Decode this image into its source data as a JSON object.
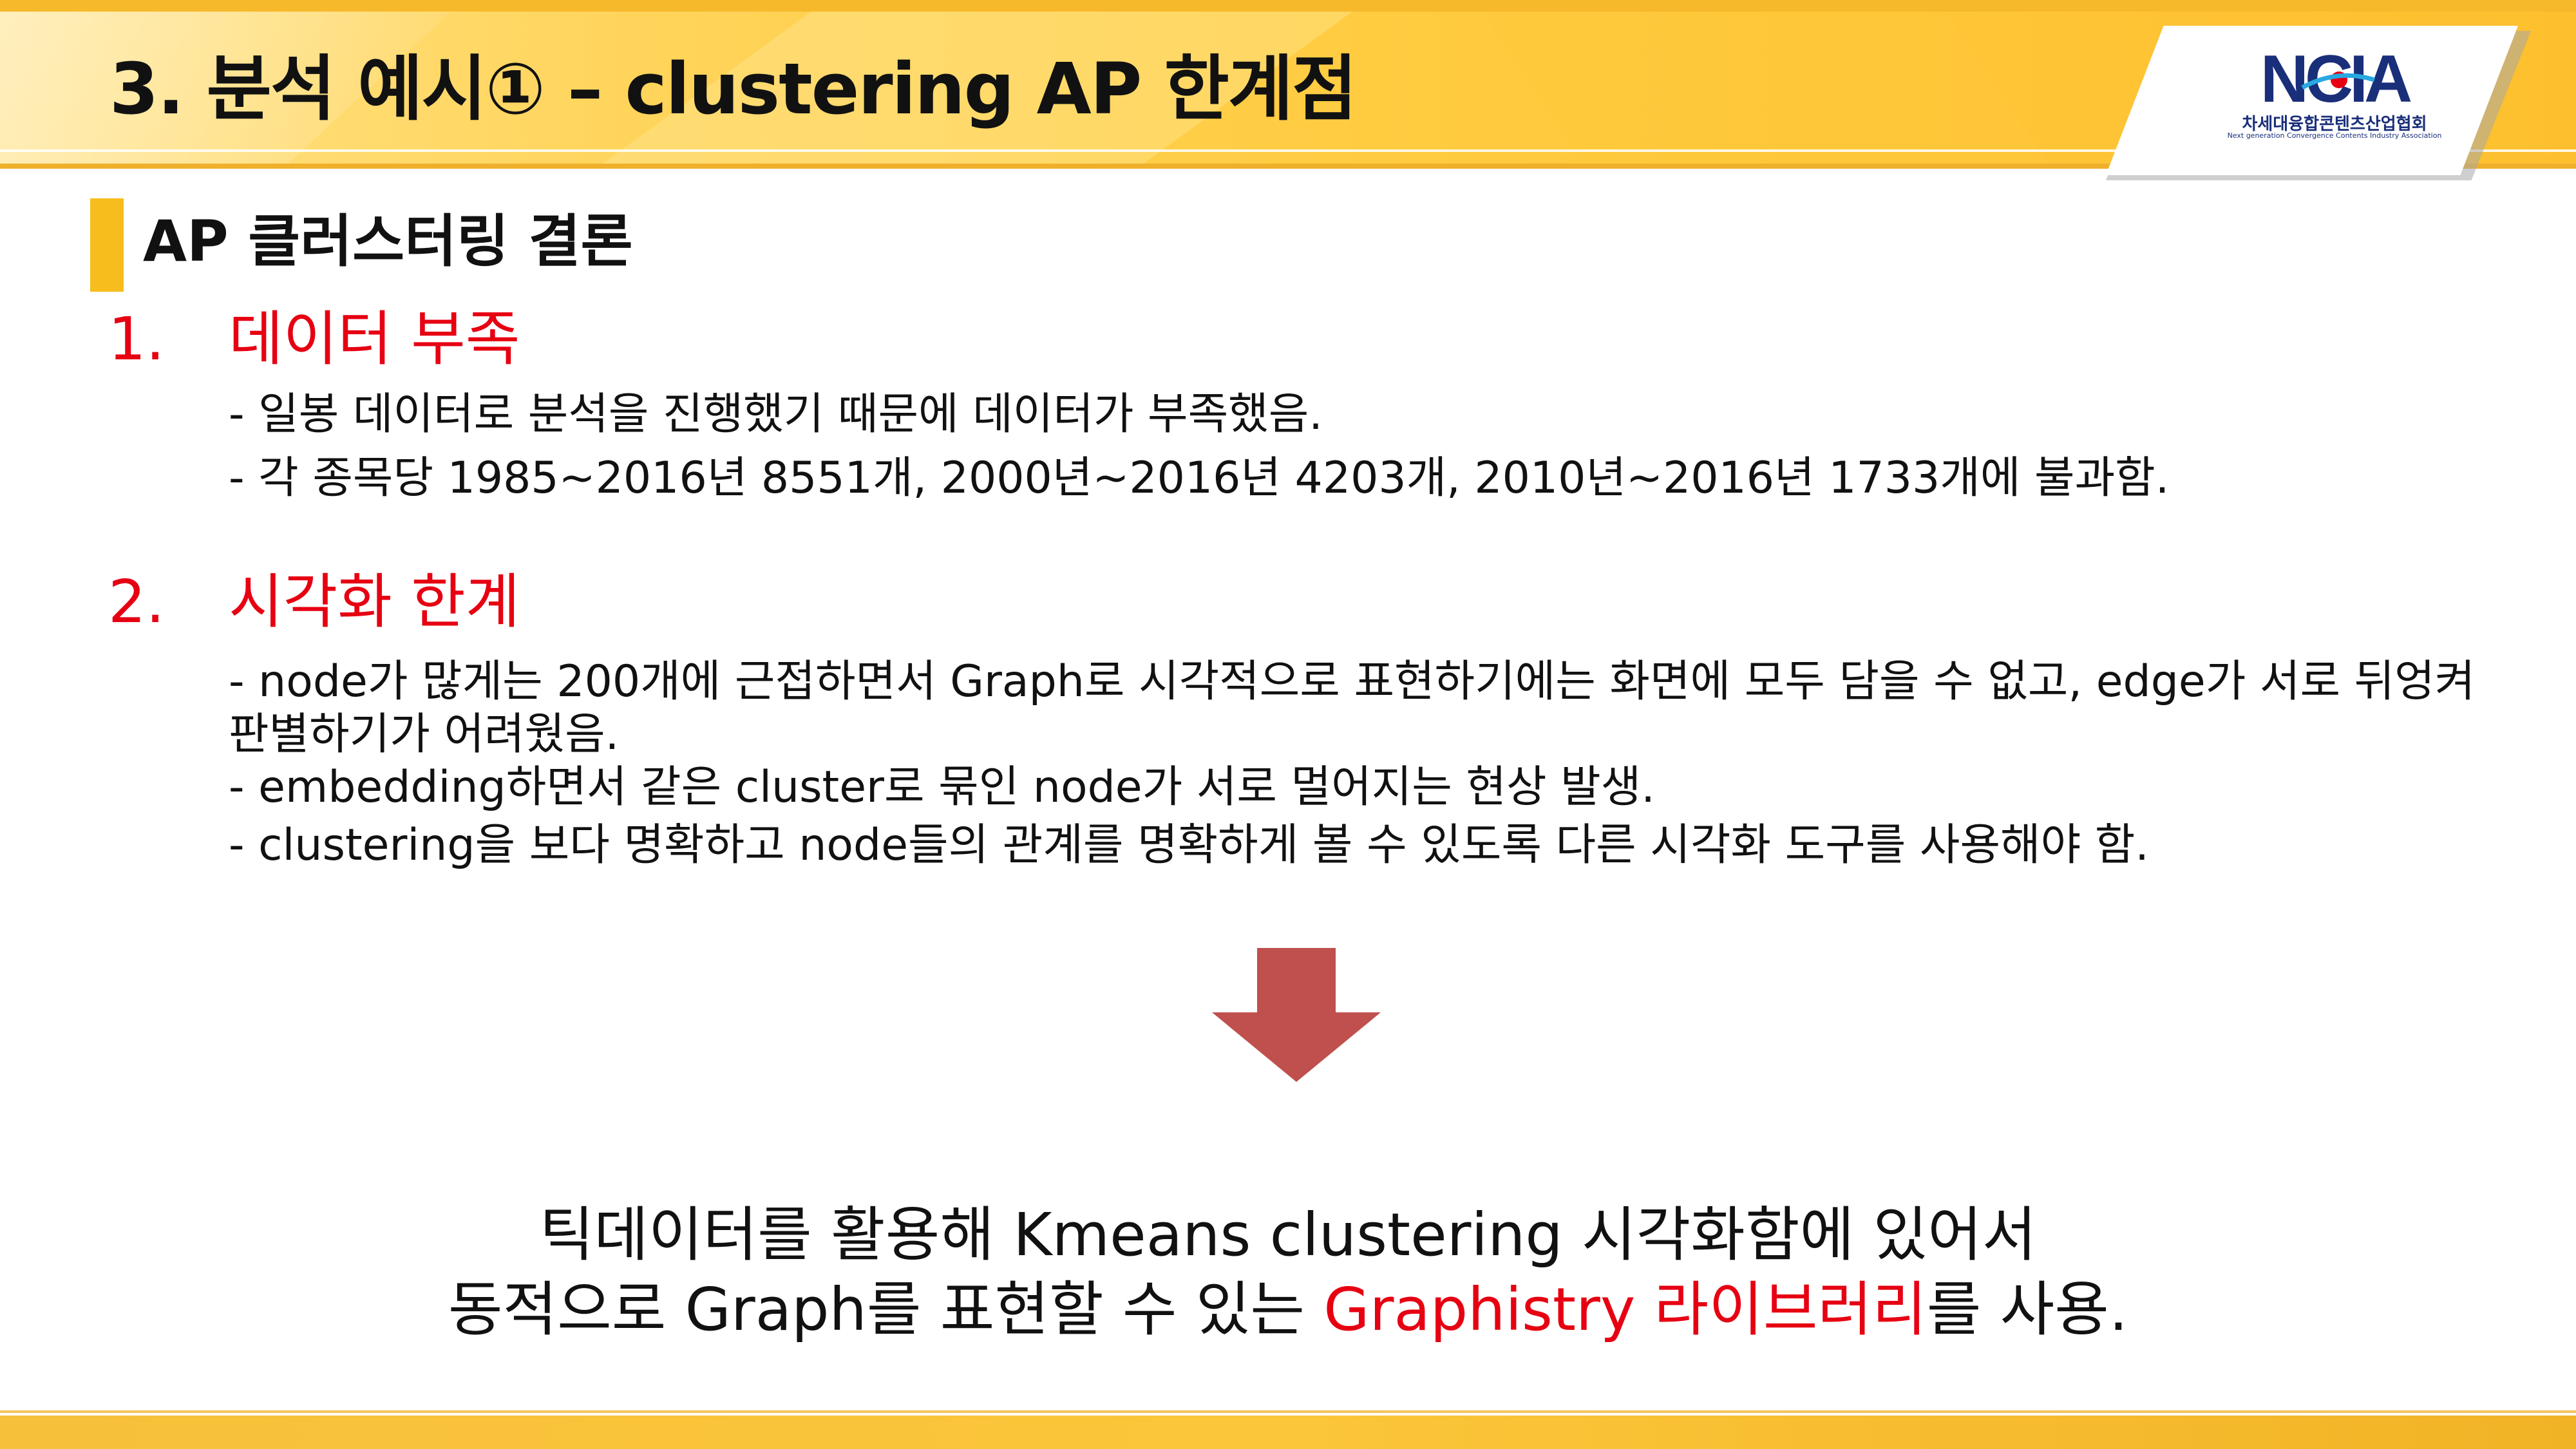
{
  "header": {
    "title": "3. 분석 예시① – clustering AP 한계점"
  },
  "logo": {
    "mark": "NCIA",
    "korean_name": "차세대융합콘텐츠산업협회",
    "english_name": "Next generation Convergence Contents Industry Association",
    "colors": {
      "navy": "#1a2f7a",
      "red": "#e60012",
      "cyan": "#28a8e0"
    }
  },
  "section": {
    "title": "AP 클러스터링 결론"
  },
  "items": [
    {
      "number": "1.",
      "title": "데이터 부족",
      "bullets": [
        "- 일봉 데이터로 분석을 진행했기 때문에 데이터가 부족했음.",
        "- 각 종목당 1985~2016년 8551개, 2000년~2016년 4203개, 2010년~2016년 1733개에 불과함."
      ]
    },
    {
      "number": "2.",
      "title": "시각화 한계",
      "bullets": [
        "- node가 많게는 200개에 근접하면서 Graph로 시각적으로 표현하기에는 화면에 모두 담을 수 없고, edge가 서로 뒤엉켜 판별하기가 어려웠음.",
        "- embedding하면서 같은 cluster로 묶인 node가 서로 멀어지는 현상 발생.",
        "- clustering을 보다 명확하고 node들의 관계를 명확하게 볼 수 있도록 다른 시각화 도구를 사용해야 함."
      ]
    }
  ],
  "conclusion": {
    "line1": "틱데이터를 활용해 Kmeans clustering 시각화함에 있어서",
    "line2_pre": "동적으로 Graph를 표현할 수 있는 ",
    "line2_highlight": "Graphistry 라이브러리",
    "line2_post": "를 사용."
  },
  "colors": {
    "accent_yellow": "#f7bd1d",
    "highlight_red": "#e60012",
    "arrow_red": "#c0504d"
  }
}
